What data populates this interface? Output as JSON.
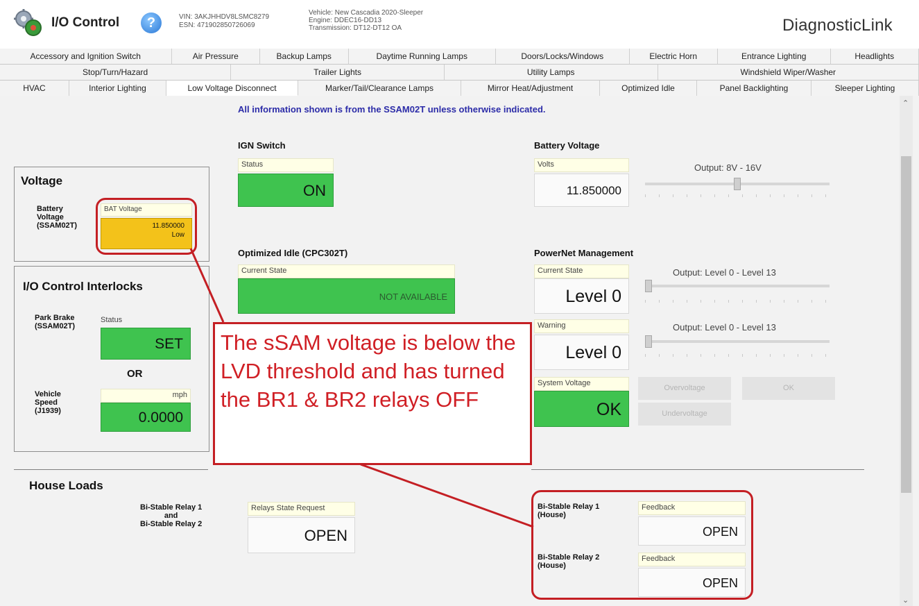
{
  "header": {
    "app_title": "I/O Control",
    "vin": "VIN: 3AKJHHDV8LSMC8279",
    "esn": "ESN: 471902850726069",
    "vehicle": "Vehicle: New Cascadia 2020-Sleeper",
    "engine": "Engine: DDEC16-DD13",
    "transmission": "Transmission: DT12-DT12 OA",
    "brand": "DiagnosticLink",
    "help_icon": "question-mark-icon",
    "app_icon": "gear-icon"
  },
  "tabs": {
    "row1": [
      "Accessory and Ignition Switch",
      "Air Pressure",
      "Backup Lamps",
      "Daytime Running Lamps",
      "Doors/Locks/Windows",
      "Electric Horn",
      "Entrance Lighting",
      "Headlights"
    ],
    "row2": [
      "Stop/Turn/Hazard",
      "Trailer Lights",
      "Utility Lamps",
      "Windshield Wiper/Washer"
    ],
    "row3": [
      "HVAC",
      "Interior Lighting",
      "Low Voltage Disconnect",
      "Marker/Tail/Clearance Lamps",
      "Mirror Heat/Adjustment",
      "Optimized Idle",
      "Panel Backlighting",
      "Sleeper Lighting"
    ],
    "active": "Low Voltage Disconnect"
  },
  "info_line": "All information shown is from the SSAM02T unless otherwise indicated.",
  "voltage": {
    "title": "Voltage",
    "label": "Battery\nVoltage\n(SSAM02T)",
    "caption": "BAT Voltage",
    "value": "11.850000",
    "status": "Low"
  },
  "interlocks": {
    "title": "I/O Control Interlocks",
    "park_brake_label": "Park Brake\n(SSAM02T)",
    "park_brake_caption": "Status",
    "park_brake_value": "SET",
    "or": "OR",
    "speed_label": "Vehicle\nSpeed\n(J1939)",
    "speed_unit": "mph",
    "speed_value": "0.0000"
  },
  "ign_switch": {
    "title": "IGN Switch",
    "caption": "Status",
    "value": "ON"
  },
  "optimized_idle": {
    "title": "Optimized Idle (CPC302T)",
    "caption": "Current State",
    "value": "NOT AVAILABLE"
  },
  "battery_voltage": {
    "title": "Battery Voltage",
    "caption": "Volts",
    "value": "11.850000",
    "output": "Output: 8V - 16V",
    "slider_fraction": 0.5
  },
  "powernet": {
    "title": "PowerNet Management",
    "current_state_caption": "Current State",
    "current_state_value": "Level 0",
    "current_output": "Output: Level 0 - Level 13",
    "warning_caption": "Warning",
    "warning_value": "Level 0",
    "warning_output": "Output: Level 0 - Level 13",
    "system_voltage_caption": "System Voltage",
    "system_voltage_value": "OK",
    "btn_overvoltage": "Overvoltage",
    "btn_ok": "OK",
    "btn_undervoltage": "Undervoltage"
  },
  "house_loads": {
    "title": "House Loads",
    "relay_label": "Bi-Stable Relay 1\nand\nBi-Stable Relay 2",
    "request_caption": "Relays State Request",
    "request_value": "OPEN",
    "relay1_label": "Bi-Stable Relay 1\n(House)",
    "relay1_caption": "Feedback",
    "relay1_value": "OPEN",
    "relay2_label": "Bi-Stable Relay 2\n(House)",
    "relay2_caption": "Feedback",
    "relay2_value": "OPEN"
  },
  "annotation": {
    "text": "The sSAM voltage is below the LVD threshold and has turned the BR1 & BR2 relays OFF",
    "color": "#d01f25"
  },
  "colors": {
    "status_green": "#3fc34f",
    "status_yellow": "#f3c21a",
    "info_blue": "#2c2ca8"
  }
}
